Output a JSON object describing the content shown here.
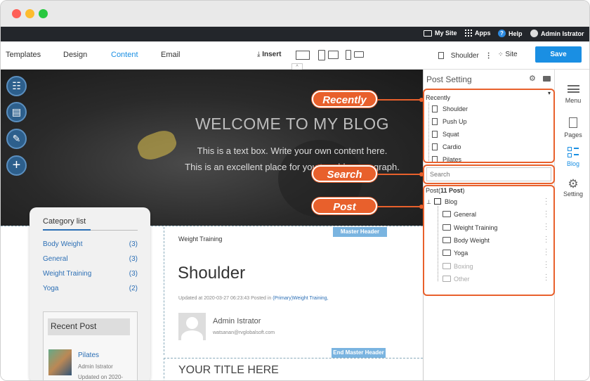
{
  "topbar": {
    "my_site": "My Site",
    "apps": "Apps",
    "help": "Help",
    "user": "Admin Istrator"
  },
  "toolbar": {
    "tabs": [
      "Templates",
      "Design",
      "Content",
      "Email"
    ],
    "active_tab": "Content",
    "insert": "Insert",
    "page_name": "Shoulder",
    "site": "Site",
    "save": "Save"
  },
  "hero": {
    "title": "WELCOME TO MY BLOG",
    "line1": "This is a text box. Write your own content here.",
    "line2": "This is an excellent place for you to add a paragraph."
  },
  "category": {
    "title": "Category list",
    "items": [
      {
        "name": "Body Weight",
        "count": "(3)"
      },
      {
        "name": "General",
        "count": "(3)"
      },
      {
        "name": "Weight Training",
        "count": "(3)"
      },
      {
        "name": "Yoga",
        "count": "(2)"
      }
    ],
    "recent_post": "Recent Post",
    "recent_item": "Pilates",
    "recent_author": "Admin Istrator",
    "recent_updated": "Updated on 2020-"
  },
  "article": {
    "master_header": "Master Header",
    "category": "Weight Training",
    "title": "Shoulder",
    "meta_prefix": "Updated at 2020-03-27 06:23:43 Posted in",
    "meta_link": "(Primary)Weight Training,",
    "author": "Admin Istrator",
    "email": "watsanan@rvglobalsoft.com",
    "end_master_header": "End Master Header",
    "your_title": "YOUR TITLE HERE"
  },
  "panel": {
    "title": "Post Setting",
    "recently_label": "Recently",
    "recent_items": [
      "Shoulder",
      "Push Up",
      "Squat",
      "Cardio",
      "Pilates"
    ],
    "search_placeholder": "Search",
    "post_count_prefix": "Post(",
    "post_count_value": "11 Post",
    "post_count_suffix": ")",
    "tree_root": "Blog",
    "tree_items": [
      {
        "label": "General",
        "active": true
      },
      {
        "label": "Weight Training",
        "active": true
      },
      {
        "label": "Body Weight",
        "active": true
      },
      {
        "label": "Yoga",
        "active": true
      },
      {
        "label": "Boxing",
        "active": false
      },
      {
        "label": "Other",
        "active": false
      }
    ]
  },
  "rightnav": {
    "menu": "Menu",
    "pages": "Pages",
    "blog": "Blog",
    "setting": "Setting"
  },
  "callouts": {
    "recently": "Recently",
    "search": "Search",
    "post": "Post"
  },
  "colors": {
    "accent": "#e8602c",
    "save": "#1a8fe3",
    "link": "#2c6fb5",
    "topbar": "#23262b"
  }
}
